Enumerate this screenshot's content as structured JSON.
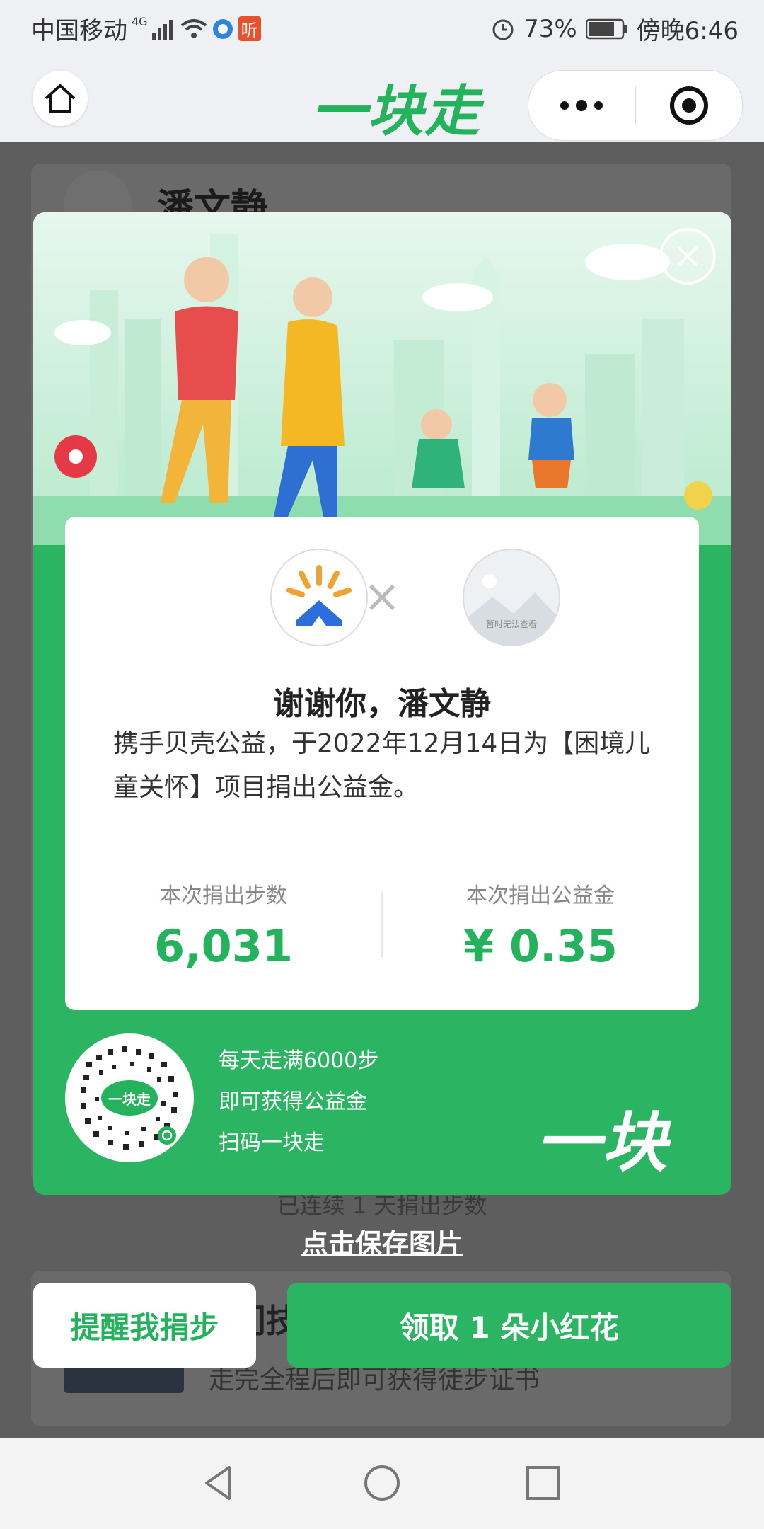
{
  "status_bar": {
    "carrier": "中国移动",
    "network": "4G",
    "app_badge": "听",
    "battery": "73%",
    "time": "傍晚6:46"
  },
  "nav": {
    "title": "一块走"
  },
  "background_page": {
    "user_name": "潘文静",
    "streak_text": "已连续 1 天捐出步数",
    "section_title_fragment": "门技",
    "section_subtitle": "走完全程后即可获得徒步证书"
  },
  "modal": {
    "partner_placeholder": "暂时无法查看",
    "thanks_text": "谢谢你，潘文静",
    "description": "携手贝壳公益，于2022年12月14日为【困境儿童关怀】项目捐出公益金。",
    "stats": [
      {
        "label": "本次捐出步数",
        "value": "6,031"
      },
      {
        "label": "本次捐出公益金",
        "value": "¥ 0.35"
      }
    ],
    "qr_label": "一块走",
    "promo_lines": [
      "每天走满6000步",
      "即可获得公益金",
      "扫码一块走"
    ],
    "brand_logo": "一块走"
  },
  "actions": {
    "save_image": "点击保存图片",
    "remind": "提醒我捐步",
    "claim": "领取 1 朵小红花"
  },
  "colors": {
    "brand_green": "#2bb462",
    "text_green": "#24b35c"
  }
}
